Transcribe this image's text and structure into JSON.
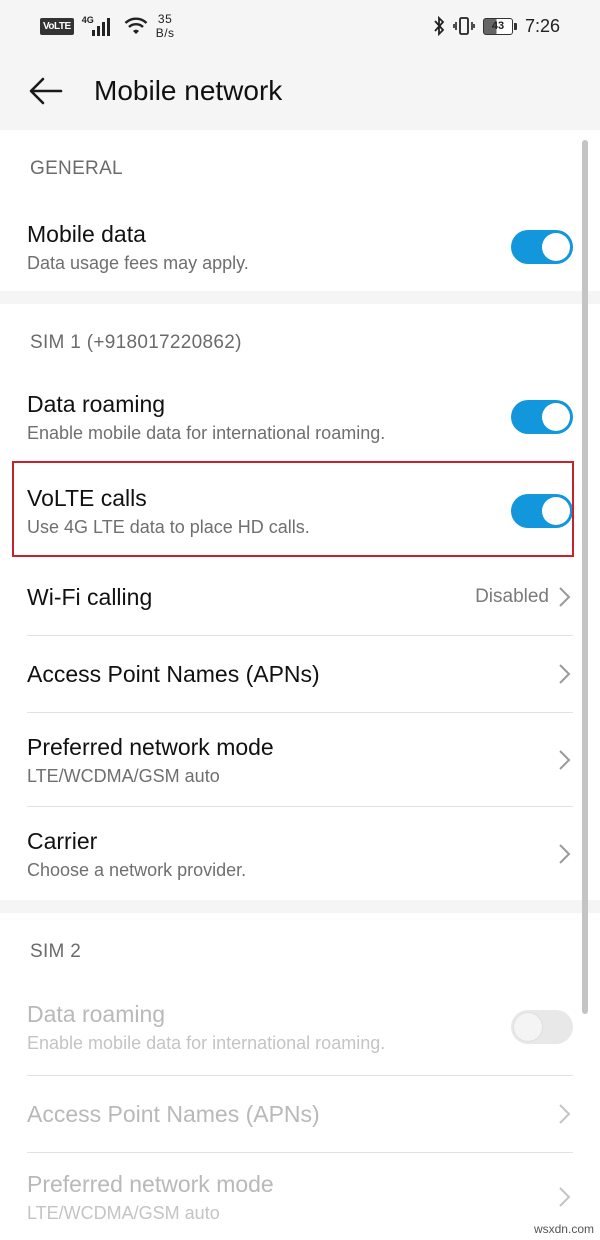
{
  "status_bar": {
    "volte": "VoLTE",
    "network_type": "4G",
    "speed_value": "35",
    "speed_unit": "B/s",
    "battery": "43",
    "time": "7:26"
  },
  "app_bar": {
    "back_icon": "arrow-left-icon",
    "title": "Mobile network"
  },
  "general": {
    "header": "GENERAL",
    "mobile_data": {
      "title": "Mobile data",
      "subtitle": "Data usage fees may apply.",
      "enabled": true
    }
  },
  "sim1": {
    "header": "SIM 1 (+918017220862)",
    "data_roaming": {
      "title": "Data roaming",
      "subtitle": "Enable mobile data for international roaming.",
      "enabled": true
    },
    "volte_calls": {
      "title": "VoLTE calls",
      "subtitle": "Use 4G LTE data to place HD calls.",
      "enabled": true
    },
    "wifi_calling": {
      "title": "Wi-Fi calling",
      "value": "Disabled"
    },
    "apns": {
      "title": "Access Point Names (APNs)"
    },
    "preferred_mode": {
      "title": "Preferred network mode",
      "subtitle": "LTE/WCDMA/GSM auto"
    },
    "carrier": {
      "title": "Carrier",
      "subtitle": "Choose a network provider."
    }
  },
  "sim2": {
    "header": "SIM 2",
    "data_roaming": {
      "title": "Data roaming",
      "subtitle": "Enable mobile data for international roaming.",
      "enabled": false
    },
    "apns": {
      "title": "Access Point Names (APNs)"
    },
    "preferred_mode": {
      "title": "Preferred network mode",
      "subtitle": "LTE/WCDMA/GSM auto"
    }
  },
  "colors": {
    "toggle_on": "#1297dd",
    "highlight_border": "#c8232c",
    "background": "#f5f5f5"
  },
  "watermark": "wsxdn.com"
}
